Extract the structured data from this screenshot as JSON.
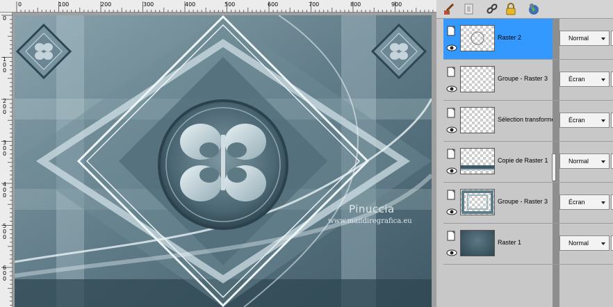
{
  "ruler": {
    "top_labels": [
      "0",
      "100",
      "200",
      "300",
      "400",
      "500",
      "600",
      "700",
      "800",
      "900"
    ],
    "left_labels": [
      "0",
      "1 0 0",
      "2 0 0",
      "3 0 0",
      "4 0 0",
      "5 0 0",
      "6 0 0"
    ]
  },
  "watermark": {
    "title": "Pinuccia",
    "url": "www.maildiregrafica.eu"
  },
  "toolbar": {
    "icons": [
      "brush-icon",
      "new-layer-icon",
      "link-icon",
      "lock-icon",
      "globe-icon"
    ]
  },
  "layers": [
    {
      "name": "Raster 2",
      "blend": "Normal",
      "selected": true,
      "thumb": "circle"
    },
    {
      "name": "Groupe - Raster 3",
      "blend": "Écran",
      "selected": false,
      "thumb": "transparent"
    },
    {
      "name": "Sélection transformée",
      "blend": "Écran",
      "selected": false,
      "thumb": "transparent"
    },
    {
      "name": "Copie de Raster 1",
      "blend": "Normal",
      "selected": false,
      "thumb": "strip"
    },
    {
      "name": "Groupe - Raster 3",
      "blend": "Écran",
      "selected": false,
      "thumb": "frame"
    },
    {
      "name": "Raster 1",
      "blend": "Normal",
      "selected": false,
      "thumb": "dark"
    }
  ],
  "colors": {
    "selection": "#3399ff",
    "art_base": "#5a7683",
    "art_light": "#c9dce3"
  }
}
